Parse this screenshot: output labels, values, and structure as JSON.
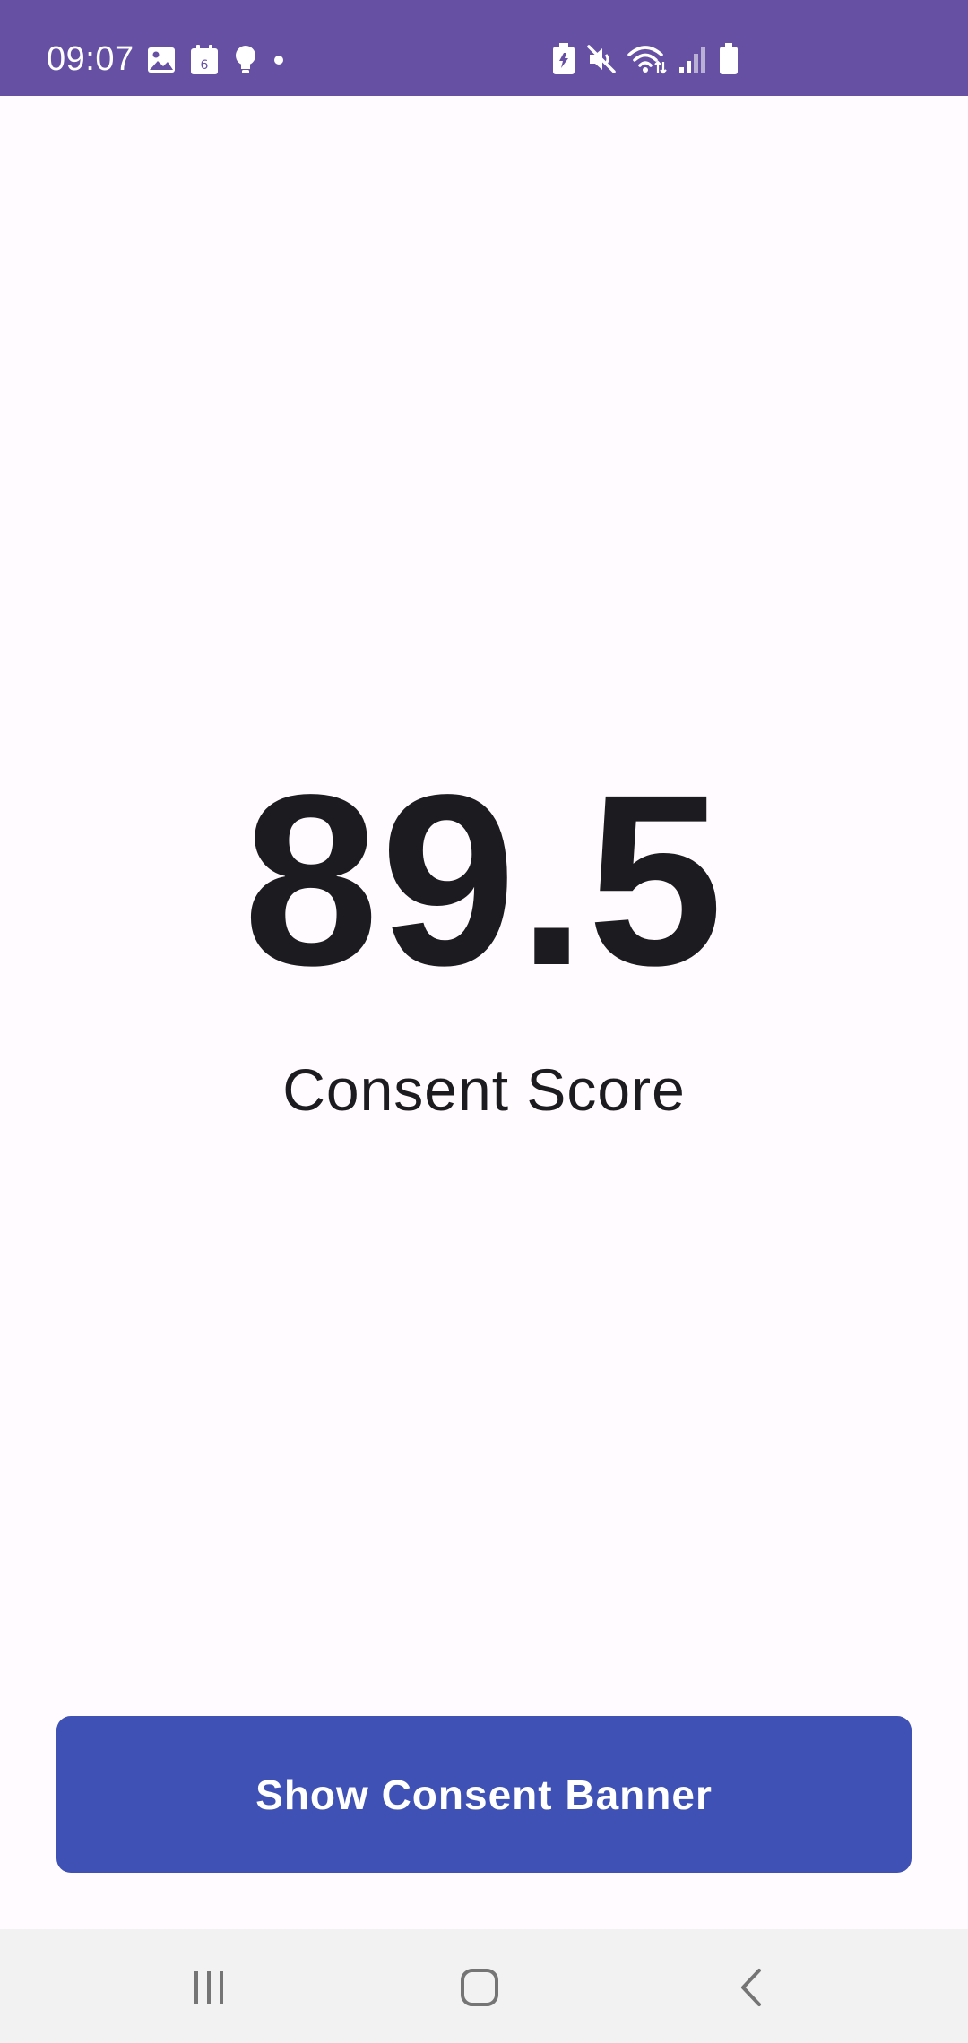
{
  "status_bar": {
    "time": "09:07",
    "background": "#6650a4",
    "left_icons": [
      "image-icon",
      "calendar-icon",
      "lightbulb-icon",
      "dot-icon"
    ],
    "calendar_day": "6",
    "right_icons": [
      "battery-saver-icon",
      "mute-icon",
      "wifi-icon",
      "signal-icon",
      "battery-icon"
    ]
  },
  "main": {
    "score_value": "89.5",
    "score_label": "Consent Score",
    "button_label": "Show Consent Banner",
    "button_color": "#3f51b5"
  },
  "nav_bar": {
    "buttons": [
      "recent-apps-icon",
      "home-icon",
      "back-icon"
    ]
  }
}
